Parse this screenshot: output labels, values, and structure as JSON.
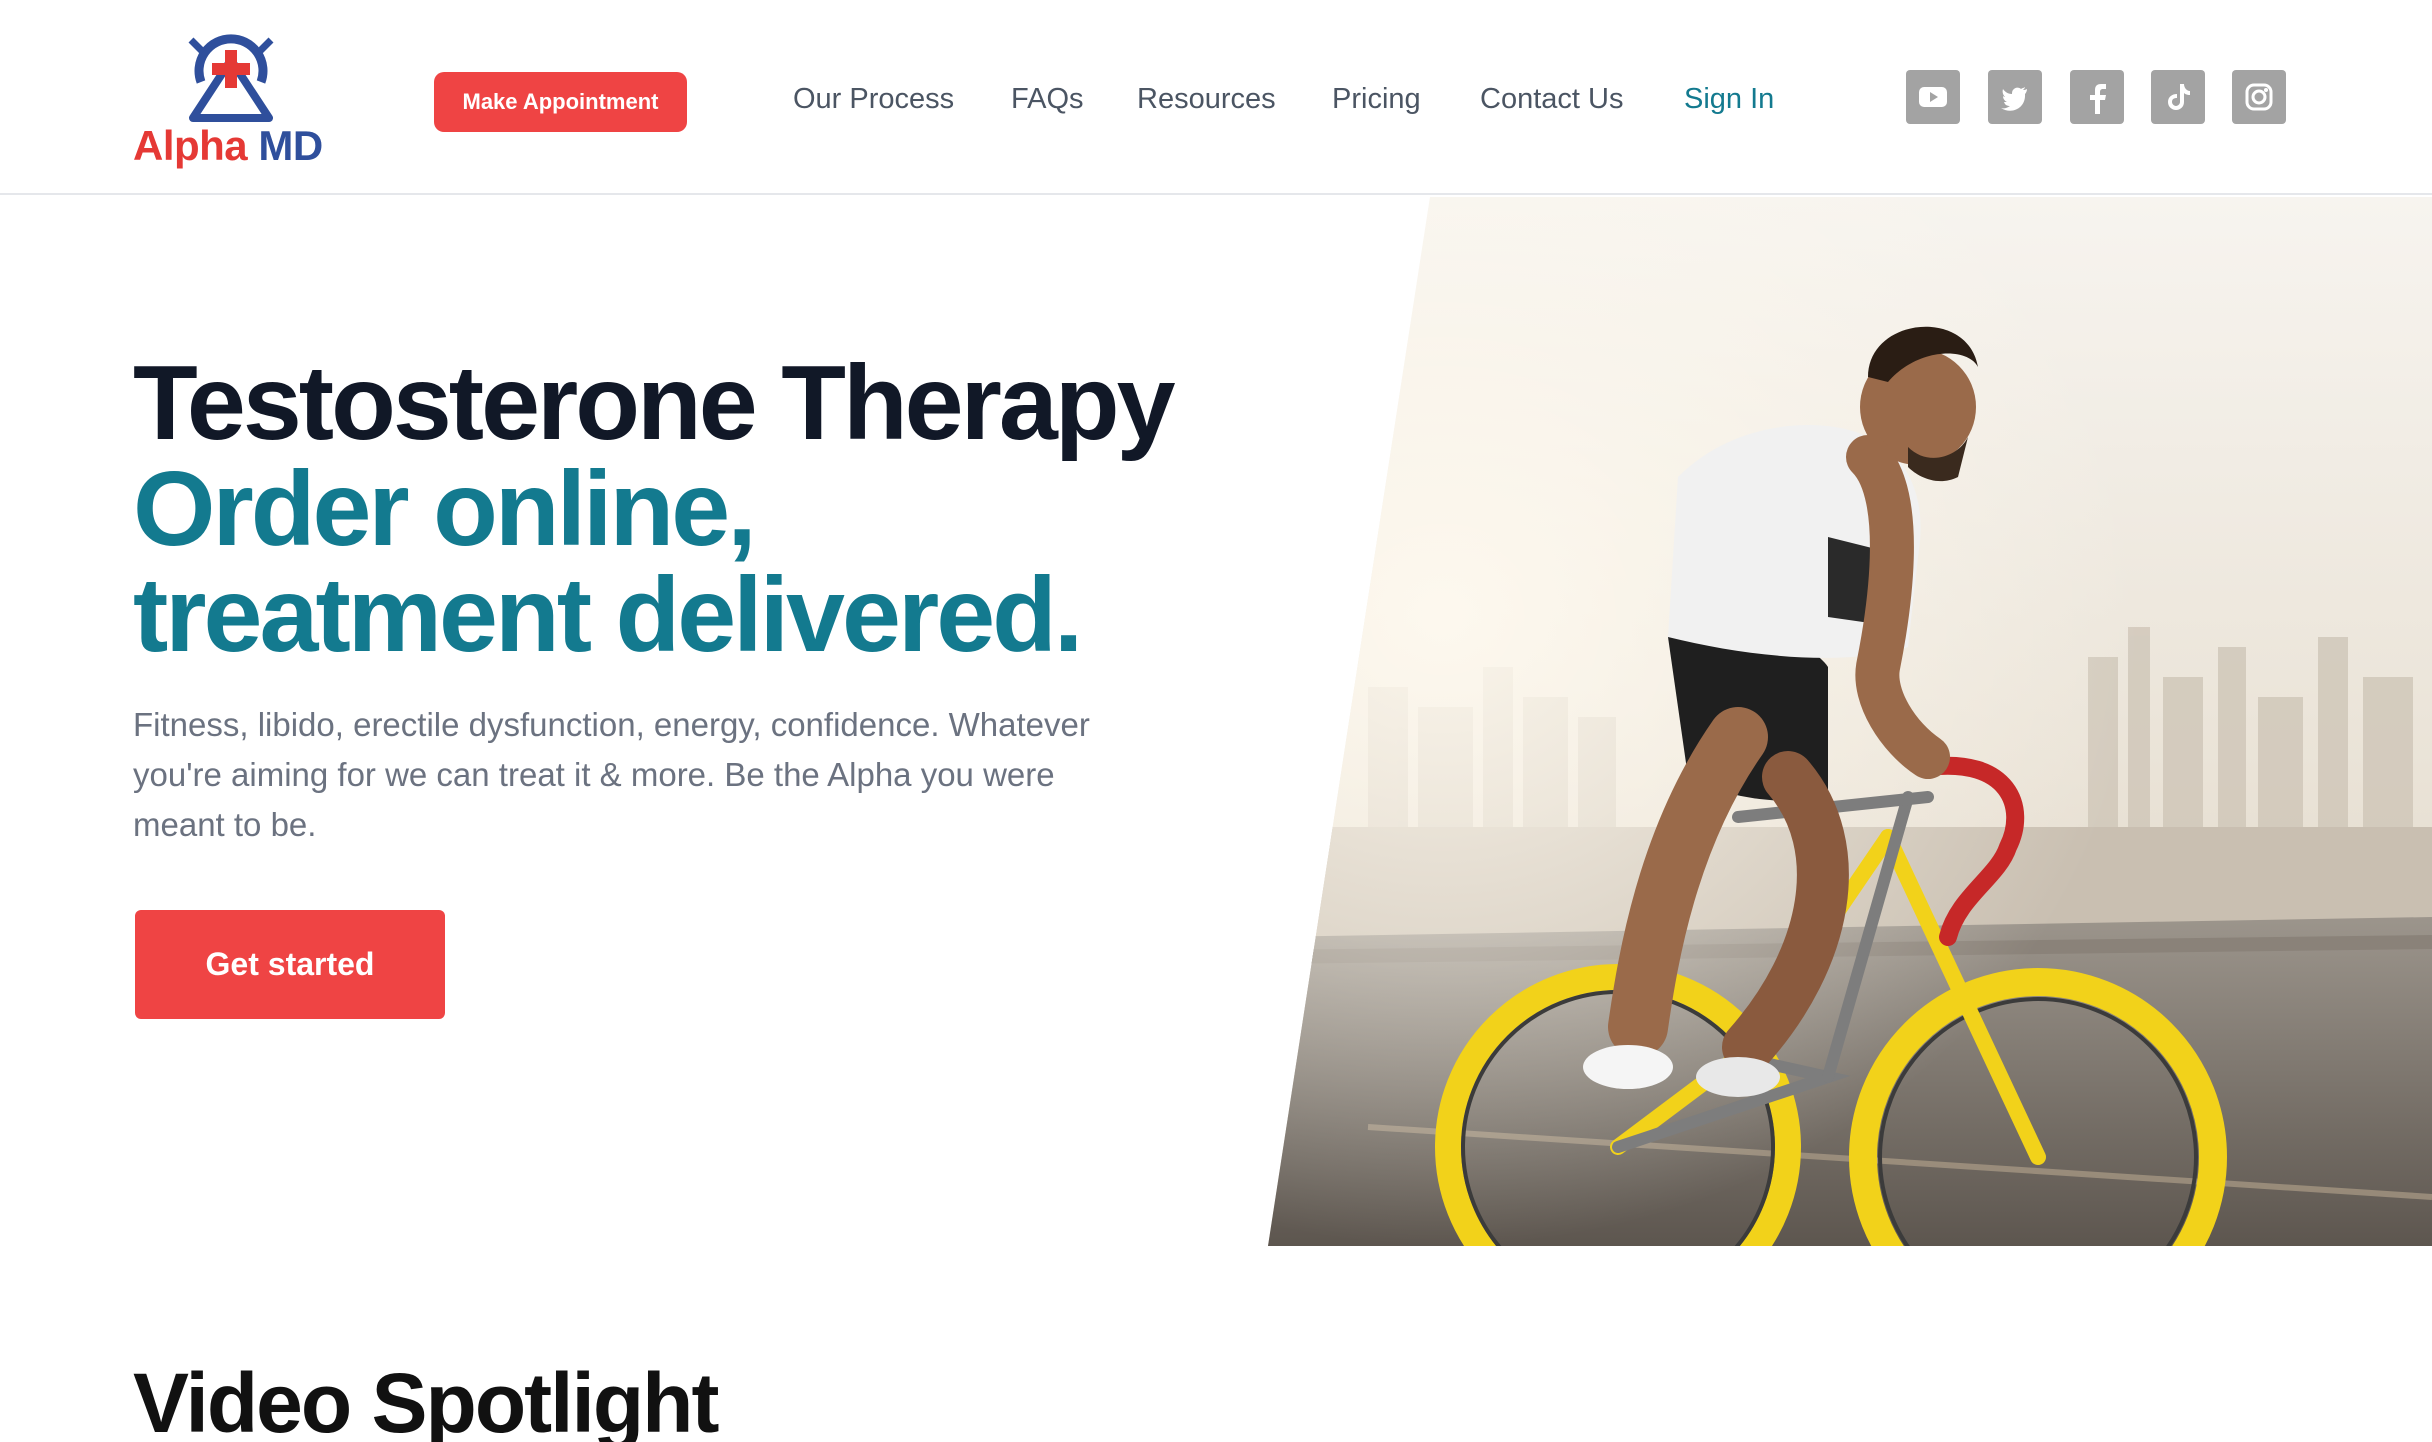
{
  "brand": {
    "name_part1": "Alpha",
    "name_part2": "MD"
  },
  "header": {
    "appointment_button": "Make Appointment",
    "nav": [
      "Our Process",
      "FAQs",
      "Resources",
      "Pricing",
      "Contact Us"
    ],
    "sign_in": "Sign In",
    "social_icons": [
      "youtube-icon",
      "twitter-icon",
      "facebook-icon",
      "tiktok-icon",
      "instagram-icon"
    ]
  },
  "hero": {
    "title_line1": "Testosterone Therapy",
    "title_line2": "Order online,",
    "title_line3": "treatment delivered.",
    "description": "Fitness, libido, erectile dysfunction, energy, confidence. Whatever you're aiming for we can treat it & more. Be the Alpha you were meant to be.",
    "cta": "Get started"
  },
  "sections": {
    "video_spotlight": "Video Spotlight"
  },
  "colors": {
    "accent_red": "#ef4444",
    "teal": "#137a8f",
    "logo_blue": "#2f4f9c",
    "icon_gray": "#a3a3a3"
  }
}
